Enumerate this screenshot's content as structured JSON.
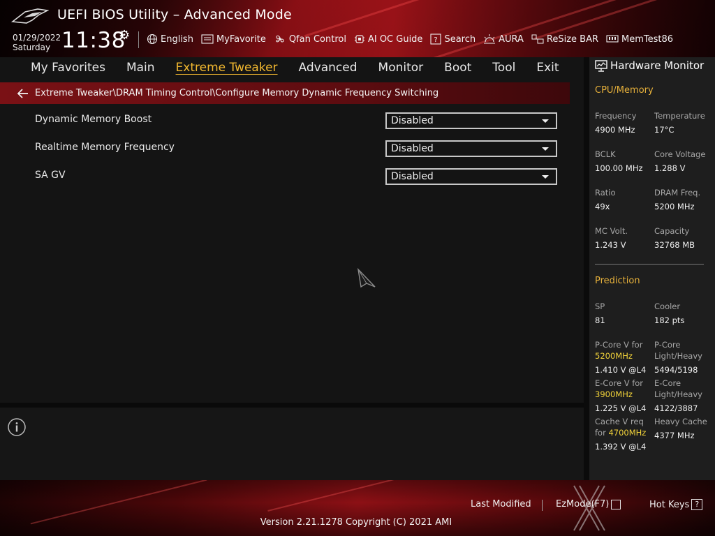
{
  "header": {
    "title": "UEFI BIOS Utility – Advanced Mode",
    "date": "01/29/2022",
    "day": "Saturday",
    "time": "11:38",
    "toolbar": [
      {
        "label": "English",
        "icon": "globe-icon"
      },
      {
        "label": "MyFavorite",
        "icon": "favorite-icon"
      },
      {
        "label": "Qfan Control",
        "icon": "fan-icon"
      },
      {
        "label": "AI OC Guide",
        "icon": "chip-icon"
      },
      {
        "label": "Search",
        "icon": "search-icon"
      },
      {
        "label": "AURA",
        "icon": "aura-icon"
      },
      {
        "label": "ReSize BAR",
        "icon": "resize-bar-icon"
      },
      {
        "label": "MemTest86",
        "icon": "memory-icon"
      }
    ]
  },
  "nav": {
    "items": [
      "My Favorites",
      "Main",
      "Extreme Tweaker",
      "Advanced",
      "Monitor",
      "Boot",
      "Tool",
      "Exit"
    ],
    "active": "Extreme Tweaker"
  },
  "breadcrumb": "Extreme Tweaker\\DRAM Timing Control\\Configure Memory Dynamic Frequency Switching",
  "settings": [
    {
      "label": "Dynamic Memory Boost",
      "value": "Disabled"
    },
    {
      "label": "Realtime Memory Frequency",
      "value": "Disabled"
    },
    {
      "label": "SA GV",
      "value": "Disabled"
    }
  ],
  "hardware_monitor": {
    "title": "Hardware Monitor",
    "cpu_memory": {
      "section": "CPU/Memory",
      "items": [
        {
          "key": "Frequency",
          "value": "4900 MHz"
        },
        {
          "key": "Temperature",
          "value": "17°C"
        },
        {
          "key": "BCLK",
          "value": "100.00 MHz"
        },
        {
          "key": "Core Voltage",
          "value": "1.288 V"
        },
        {
          "key": "Ratio",
          "value": "49x"
        },
        {
          "key": "DRAM Freq.",
          "value": "5200 MHz"
        },
        {
          "key": "MC Volt.",
          "value": "1.243 V"
        },
        {
          "key": "Capacity",
          "value": "32768 MB"
        }
      ]
    },
    "prediction": {
      "section": "Prediction",
      "sp_key": "SP",
      "sp_value": "81",
      "cooler_key": "Cooler",
      "cooler_value": "182 pts",
      "pcore_v_key": "P-Core V for",
      "pcore_v_freq": "5200MHz",
      "pcore_v_value": "1.410 V @L4",
      "pcore_lh_key": "P-Core",
      "pcore_lh_key2": "Light/Heavy",
      "pcore_lh_value": "5494/5198",
      "ecore_v_key": "E-Core V for",
      "ecore_v_freq": "3900MHz",
      "ecore_v_value": "1.225 V @L4",
      "ecore_lh_key": "E-Core",
      "ecore_lh_key2": "Light/Heavy",
      "ecore_lh_value": "4122/3887",
      "cache_v_key": "Cache V req",
      "cache_v_key2": "for",
      "cache_v_freq": "4700MHz",
      "cache_v_value": "1.392 V @L4",
      "heavy_cache_key": "Heavy Cache",
      "heavy_cache_value": "4377 MHz"
    }
  },
  "footer": {
    "last_modified": "Last Modified",
    "ezmode": "EzMode(F7)",
    "hotkeys": "Hot Keys",
    "hotkeys_glyph": "?",
    "version": "Version 2.21.1278 Copyright (C) 2021 AMI"
  },
  "colors": {
    "accent": "#f1b72f",
    "section_title": "#e7b13b",
    "highlight": "#f2d33a",
    "breadcrumb_bg": "#7a1115"
  }
}
